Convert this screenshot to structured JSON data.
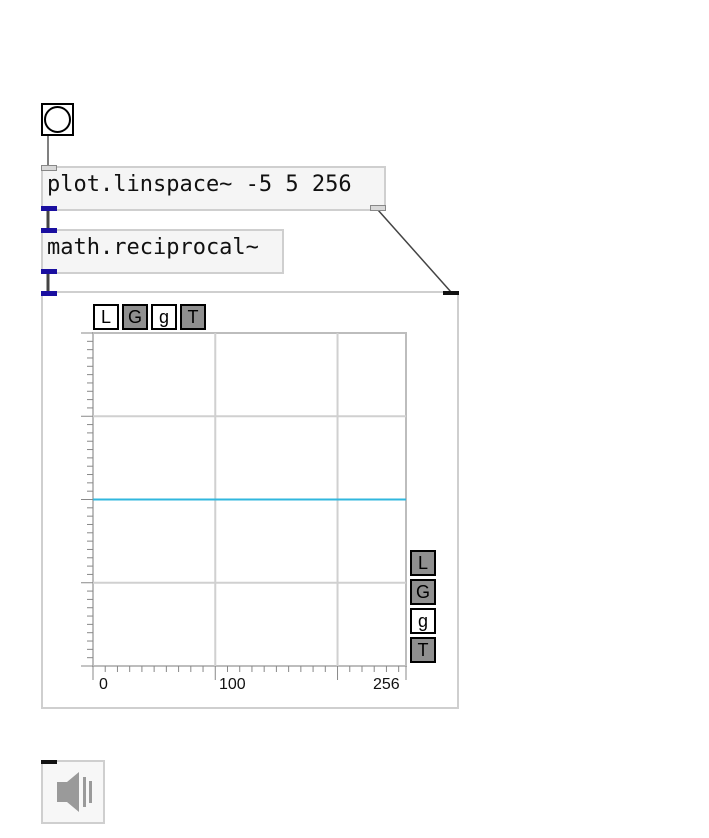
{
  "objects": {
    "linspace": "plot.linspace~ -5 5 256",
    "reciprocal": "math.reciprocal~"
  },
  "plot": {
    "top_toggles": [
      {
        "label": "L",
        "state": "off"
      },
      {
        "label": "G",
        "state": "on"
      },
      {
        "label": "g",
        "state": "off"
      },
      {
        "label": "T",
        "state": "on"
      }
    ],
    "side_toggles": [
      {
        "label": "L",
        "state": "on"
      },
      {
        "label": "G",
        "state": "on"
      },
      {
        "label": "g",
        "state": "off"
      },
      {
        "label": "T",
        "state": "on"
      }
    ],
    "x_tick_labels": [
      "0",
      "100",
      "256"
    ]
  },
  "chart_data": {
    "type": "line",
    "x_ticks": [
      0,
      100,
      256
    ],
    "xlim": [
      0,
      256
    ],
    "grid": true,
    "series": [
      {
        "color": "#31b7de",
        "x": [
          0,
          256
        ],
        "y": [
          0,
          0
        ]
      }
    ]
  },
  "colors": {
    "inlet": "#1a0fa0",
    "line": "#31b7de",
    "box_border": "#cfcfcf"
  },
  "icons": {
    "bang": "bang-circle-icon",
    "speaker": "speaker-icon"
  }
}
